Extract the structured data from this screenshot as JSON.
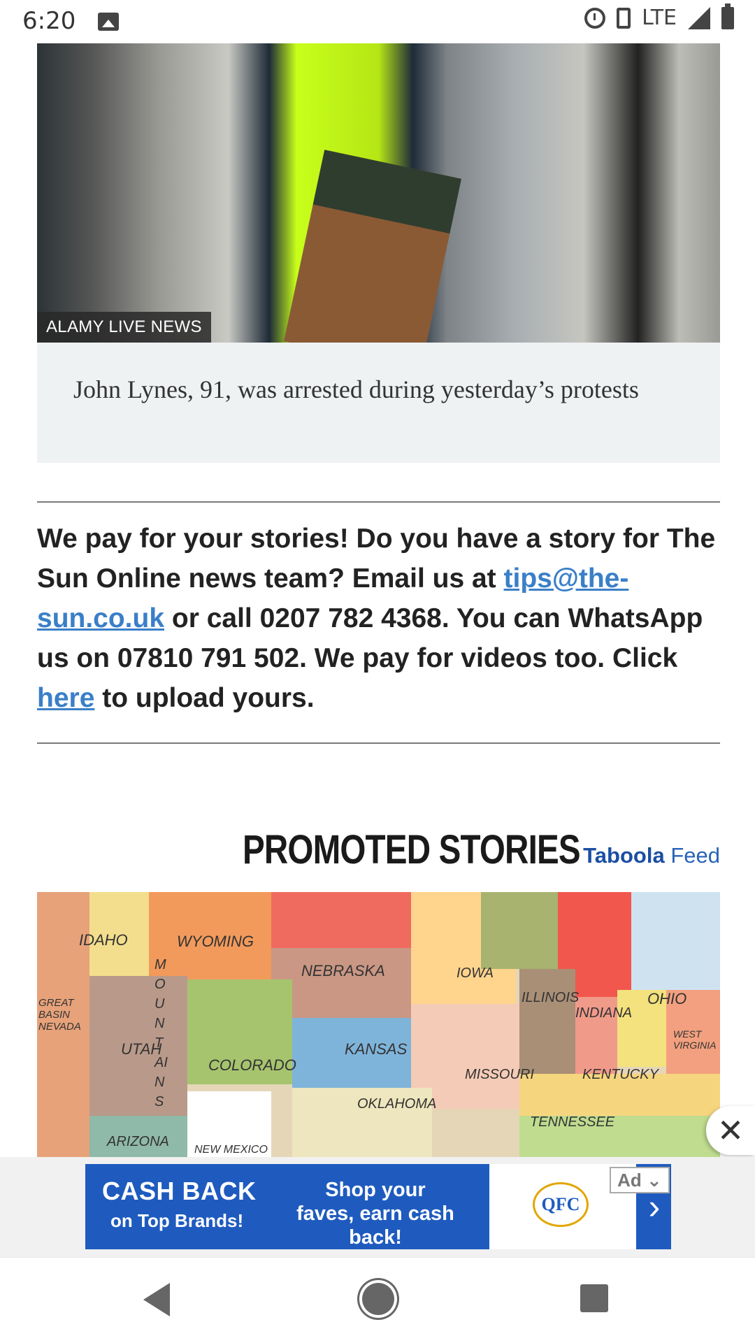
{
  "status_bar": {
    "time": "6:20",
    "network": "LTE"
  },
  "article": {
    "image_credit": "ALAMY LIVE NEWS",
    "caption": "John Lynes, 91, was arrested during yesterday’s protests",
    "tips": {
      "part1": "We pay for your stories! Do you have a story for The Sun Online news team? Email us at ",
      "email_link": "tips@the-sun.co.uk",
      "part2": " or call 0207 782 4368. You can WhatsApp us on 07810 791 502. We pay for videos too. Click ",
      "here_link": "here",
      "part3": " to upload yours."
    }
  },
  "promoted": {
    "title": "PROMOTED STORIES",
    "brand": "Taboola",
    "feed_label": "Feed"
  },
  "map": {
    "labels": [
      "IDAHO",
      "WYOMING",
      "NEBRASKA",
      "IOWA",
      "ILLINOIS",
      "INDIANA",
      "OHIO",
      "UTAH",
      "COLORADO",
      "KANSAS",
      "MISSOURI",
      "KENTUCKY",
      "OKLAHOMA",
      "TENNESSEE",
      "ARIZONA",
      "GREAT BASIN NEVADA",
      "MOUNTAINS",
      "NEW MEXICO",
      "WEST VIRGINIA"
    ]
  },
  "ad": {
    "cash_back": "CASH BACK",
    "cash_back_sub": "on Top Brands!",
    "shop_text": "Shop your faves, earn cash back!",
    "logo_text": "QFC",
    "badge": "Ad ⌄",
    "arrow": "›"
  },
  "close_button": "✕"
}
